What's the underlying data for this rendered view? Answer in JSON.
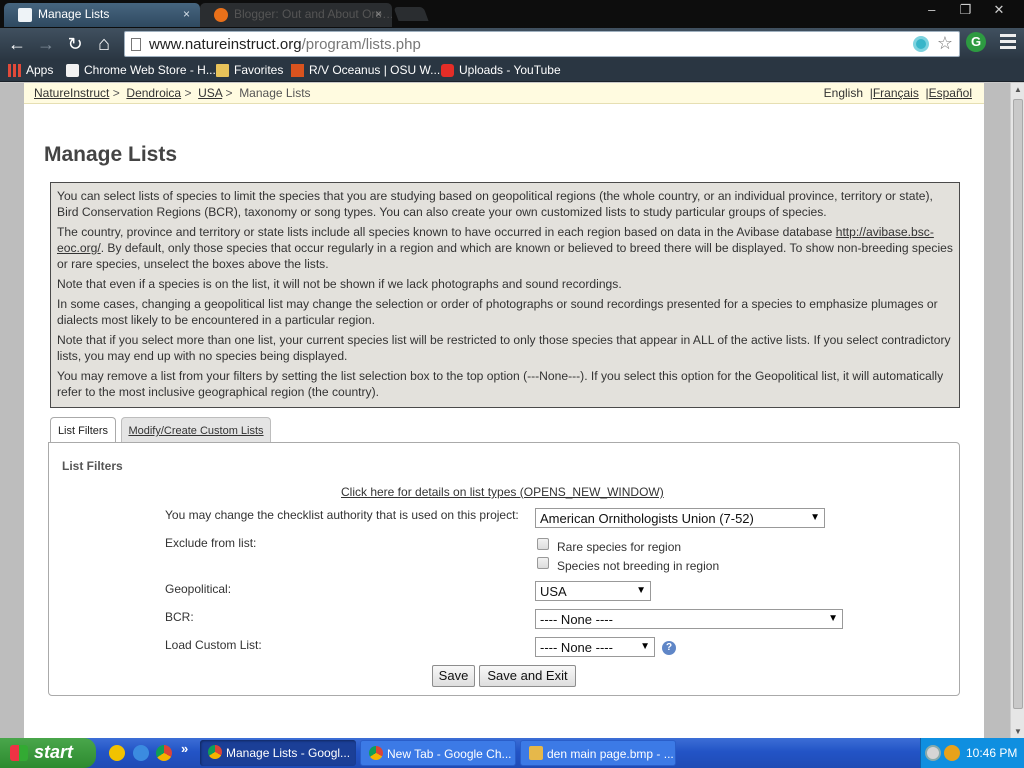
{
  "browser": {
    "tabs": [
      {
        "title": "Manage Lists",
        "close": "×",
        "active": true
      },
      {
        "title": "Blogger: Out and About Ore…",
        "close": "×",
        "active": false
      }
    ],
    "window_buttons": {
      "minimize": "–",
      "maximize": "❐",
      "close": "✕"
    },
    "nav": {
      "back": "←",
      "forward": "→",
      "reload": "↻",
      "home": "⌂"
    },
    "url": {
      "host": "www.natureinstruct.org",
      "path": "/program/lists.php"
    },
    "bookmarks": [
      {
        "label": "Apps",
        "icon": "apps-grid-icon"
      },
      {
        "label": "Chrome Web Store - H...",
        "icon": "chrome-web-store-icon"
      },
      {
        "label": "Favorites",
        "icon": "folder-icon"
      },
      {
        "label": "R/V Oceanus | OSU W...",
        "icon": "osu-icon"
      },
      {
        "label": "Uploads - YouTube",
        "icon": "youtube-icon"
      }
    ]
  },
  "page": {
    "breadcrumbs": [
      {
        "label": "NatureInstruct",
        "link": true
      },
      {
        "label": "Dendroica",
        "link": true
      },
      {
        "label": "USA",
        "link": true
      },
      {
        "label": "Manage Lists",
        "link": false
      }
    ],
    "breadcrumb_separator": ">",
    "languages": {
      "current": "English",
      "fr": "Français",
      "es": "Español",
      "separator": "|"
    },
    "title": "Manage Lists",
    "info": {
      "p1": "You can select lists of species to limit the species that you are studying based on geopolitical regions (the whole country, or an individual province, territory or state), Bird Conservation Regions (BCR), taxonomy or song types. You can also create your own customized lists to study particular groups of species.",
      "p2_before": "The country, province and territory or state lists include all species known to have occurred in each region based on data in the Avibase database ",
      "p2_link": "http://avibase.bsc-eoc.org/",
      "p2_after": ". By default, only those species that occur regularly in a region and which are known or believed to breed there will be displayed. To show non-breeding species or rare species, unselect the boxes above the lists.",
      "p3": "Note that even if a species is on the list, it will not be shown if we lack photographs and sound recordings.",
      "p4": "In some cases, changing a geopolitical list may change the selection or order of photographs or sound recordings presented for a species to emphasize plumages or dialects most likely to be encountered in a particular region.",
      "p5": "Note that if you select more than one list, your current species list will be restricted to only those species that appear in ALL of the active lists. If you select contradictory lists, you may end up with no species being displayed.",
      "p6": "You may remove a list from your filters by setting the list selection box to the top option (---None---). If you select this option for the Geopolitical list, it will automatically refer to the most inclusive geographical region (the country)."
    },
    "tabs": {
      "filters": "List Filters",
      "custom": "Modify/Create Custom Lists"
    },
    "panel": {
      "heading": "List Filters",
      "details_link": "Click here for details on list types (OPENS_NEW_WINDOW)",
      "authority_label": "You may change the checklist authority that is used on this project:",
      "authority_value": "American Ornithologists Union (7-52)",
      "exclude_label": "Exclude from list:",
      "rare_label": "Rare species for region",
      "rare_checked": false,
      "nonbreeding_label": "Species not breeding in region",
      "nonbreeding_checked": false,
      "geo_label": "Geopolitical:",
      "geo_value": "USA",
      "bcr_label": "BCR:",
      "bcr_value": "---- None ----",
      "custom_label": "Load Custom List:",
      "custom_value": "---- None ----",
      "help": "?",
      "save": "Save",
      "save_exit": "Save and Exit"
    }
  },
  "taskbar": {
    "start": "start",
    "overflow": "»",
    "tasks": [
      {
        "label": "Manage Lists - Googl...",
        "active": true
      },
      {
        "label": "New Tab - Google Ch...",
        "active": false
      },
      {
        "label": "den main page.bmp - ...",
        "active": false
      }
    ],
    "clock": "10:46 PM"
  },
  "colors": {
    "crumb_bar": "#fffbe0",
    "info_box": "#e3e1dc",
    "taskbar": "#2354c6",
    "start": "#3a9a3c",
    "tray": "#0f8fe0"
  }
}
